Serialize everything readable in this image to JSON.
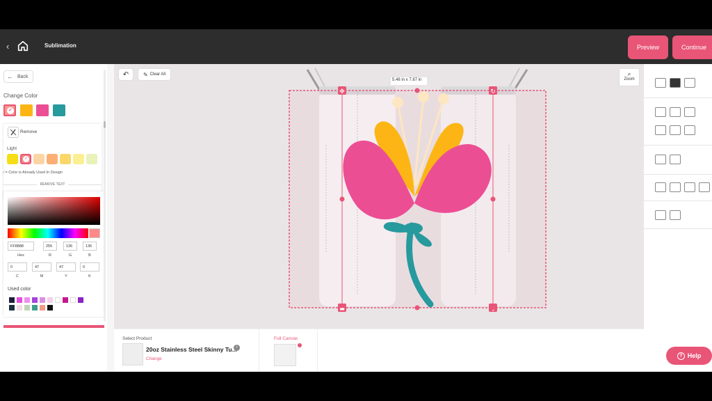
{
  "header": {
    "title": "Sublimation",
    "preview_label": "Preview",
    "continue_label": "Continue"
  },
  "left_panel": {
    "back_label": "Back",
    "change_color_title": "Change Color",
    "current_colors": [
      "#f8978b",
      "#fdb515",
      "#ec4e94",
      "#279a9e"
    ],
    "remove_label": "Remove",
    "light_label": "Light",
    "light_colors": [
      "#f5de16",
      "#f08a8a",
      "#fbd5a6",
      "#fcaf74",
      "#fbd76a",
      "#fbef92",
      "#e8f2b9"
    ],
    "used_note": "= Color is Already Used In Design",
    "remove_text_label": "REMOVE TEXT",
    "picker": {
      "hex_value": "FF8888",
      "r_value": "255",
      "g_value": "136",
      "b_value": "136",
      "c_value": "0",
      "m_value": "47",
      "y_value": "47",
      "k_value": "0",
      "hex_label": "Hex",
      "r_label": "R",
      "g_label": "G",
      "b_label": "B",
      "c_label": "C",
      "m_label": "M",
      "y_label": "Y",
      "k_label": "K"
    },
    "used_color_label": "Used color",
    "used_colors": [
      "#1d1d3f",
      "#e44fe0",
      "#f08ef0",
      "#a444d8",
      "#d98fe5",
      "#f2d2ea",
      "#ffffff",
      "#c2188b",
      "#ffffff",
      "#8d22c0",
      "#1c2f3c",
      "#f2dde2",
      "#bcd7b7",
      "#3f9e8c",
      "#f59a86",
      "#111111"
    ]
  },
  "canvas": {
    "clear_all_label": "Clear All",
    "zoom_label": "Zoom",
    "dimension_label": "5.46 in x 7.87 in"
  },
  "product": {
    "select_label": "Select Product",
    "name": "20oz Stainless Steel Skinny Tu...",
    "change_label": "Change",
    "full_canvas_label": "Full Canvas"
  },
  "help_label": "Help",
  "colors": {
    "accent": "#e85577",
    "petal_pink": "#ec4e94",
    "petal_yellow": "#fdb515",
    "stem_teal": "#279a9e",
    "stamen": "#fde6c2"
  }
}
